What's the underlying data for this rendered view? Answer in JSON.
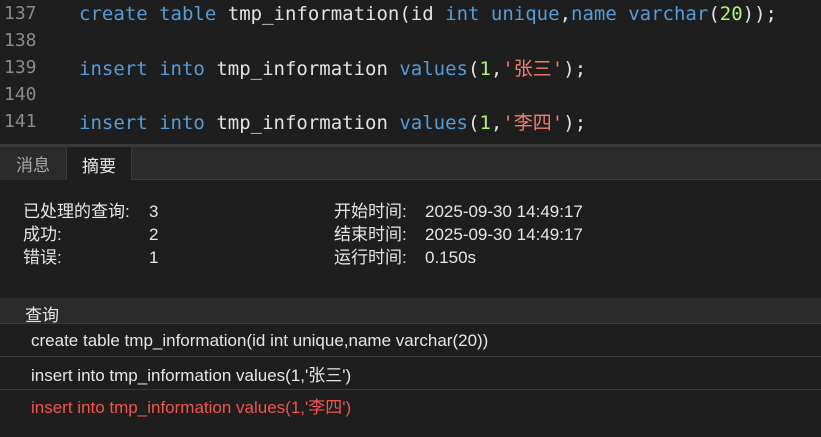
{
  "editor": {
    "lines": [
      {
        "number": "137",
        "tokens": [
          {
            "t": "create",
            "c": "kw"
          },
          {
            "t": " ",
            "c": "punc"
          },
          {
            "t": "table",
            "c": "kw"
          },
          {
            "t": " ",
            "c": "punc"
          },
          {
            "t": "tmp_information",
            "c": "id"
          },
          {
            "t": "(",
            "c": "punc"
          },
          {
            "t": "id",
            "c": "id"
          },
          {
            "t": " ",
            "c": "punc"
          },
          {
            "t": "int",
            "c": "kw"
          },
          {
            "t": " ",
            "c": "punc"
          },
          {
            "t": "unique",
            "c": "kw"
          },
          {
            "t": ",",
            "c": "punc"
          },
          {
            "t": "name",
            "c": "kw"
          },
          {
            "t": " ",
            "c": "punc"
          },
          {
            "t": "varchar",
            "c": "kw"
          },
          {
            "t": "(",
            "c": "punc"
          },
          {
            "t": "20",
            "c": "num"
          },
          {
            "t": "));",
            "c": "punc"
          }
        ]
      },
      {
        "number": "138",
        "tokens": []
      },
      {
        "number": "139",
        "tokens": [
          {
            "t": "insert",
            "c": "kw"
          },
          {
            "t": " ",
            "c": "punc"
          },
          {
            "t": "into",
            "c": "kw"
          },
          {
            "t": " ",
            "c": "punc"
          },
          {
            "t": "tmp_information",
            "c": "id"
          },
          {
            "t": " ",
            "c": "punc"
          },
          {
            "t": "values",
            "c": "kw"
          },
          {
            "t": "(",
            "c": "punc"
          },
          {
            "t": "1",
            "c": "num"
          },
          {
            "t": ",",
            "c": "punc"
          },
          {
            "t": "'张三'",
            "c": "str"
          },
          {
            "t": ");",
            "c": "punc"
          }
        ]
      },
      {
        "number": "140",
        "tokens": []
      },
      {
        "number": "141",
        "tokens": [
          {
            "t": "insert",
            "c": "kw"
          },
          {
            "t": " ",
            "c": "punc"
          },
          {
            "t": "into",
            "c": "kw"
          },
          {
            "t": " ",
            "c": "punc"
          },
          {
            "t": "tmp_information",
            "c": "id"
          },
          {
            "t": " ",
            "c": "punc"
          },
          {
            "t": "values",
            "c": "kw"
          },
          {
            "t": "(",
            "c": "punc"
          },
          {
            "t": "1",
            "c": "num"
          },
          {
            "t": ",",
            "c": "punc"
          },
          {
            "t": "'李四'",
            "c": "str"
          },
          {
            "t": ");",
            "c": "punc"
          }
        ]
      }
    ]
  },
  "tabs": {
    "messages": "消息",
    "summary": "摘要"
  },
  "summary": {
    "processed_label": "已处理的查询:",
    "processed_value": "3",
    "success_label": "成功:",
    "success_value": "2",
    "error_label": "错误:",
    "error_value": "1",
    "start_label": "开始时间:",
    "start_value": "2025-09-30 14:49:17",
    "end_label": "结束时间:",
    "end_value": "2025-09-30 14:49:17",
    "elapsed_label": "运行时间:",
    "elapsed_value": "0.150s"
  },
  "queries": {
    "header": "查询",
    "items": [
      {
        "text": "create table tmp_information(id int unique,name varchar(20))",
        "status": "ok"
      },
      {
        "text": "insert into tmp_information values(1,'张三')",
        "status": "ok"
      },
      {
        "text": "insert into tmp_information values(1,'李四')",
        "status": "error"
      }
    ]
  },
  "colors": {
    "background": "#1e1e1e",
    "keyword": "#569cd6",
    "number": "#b5f07a",
    "string": "#f07e6e",
    "error": "#f2544d"
  }
}
